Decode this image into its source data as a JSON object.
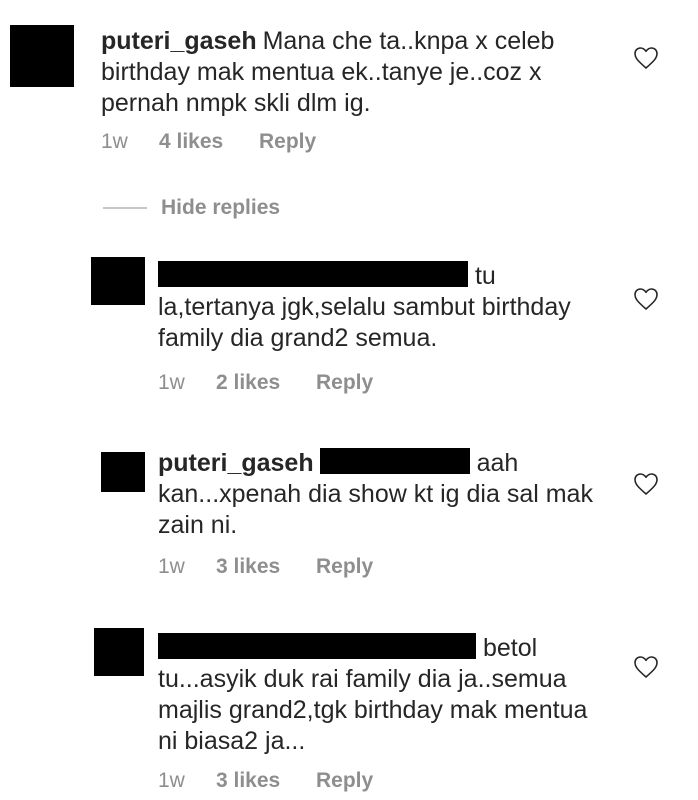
{
  "comments": [
    {
      "username": "puteri_gaseh",
      "text": "Mana che ta..knpa x celeb birthday mak mentua ek..tanye je..coz x pernah nmpk skli dlm ig.",
      "time": "1w",
      "likes": "4 likes",
      "reply": "Reply"
    }
  ],
  "hide_replies": "Hide replies",
  "replies": [
    {
      "username": "",
      "text_after": "tu la,tertanya jgk,selalu sambut birthday family dia grand2 semua.",
      "time": "1w",
      "likes": "2 likes",
      "reply": "Reply"
    },
    {
      "username": "puteri_gaseh",
      "text_after": "aah kan...xpenah dia show kt ig dia sal mak zain ni.",
      "time": "1w",
      "likes": "3 likes",
      "reply": "Reply"
    },
    {
      "username": "",
      "text_after": "betol tu...asyik duk rai  family dia ja..semua majlis grand2,tgk birthday mak mentua ni biasa2 ja...",
      "time": "1w",
      "likes": "3 likes",
      "reply": "Reply"
    }
  ],
  "icons": {
    "like": "heart-outline-icon"
  },
  "colors": {
    "text": "#262626",
    "muted": "#8e8e8e",
    "divider": "#c7c7c7"
  }
}
